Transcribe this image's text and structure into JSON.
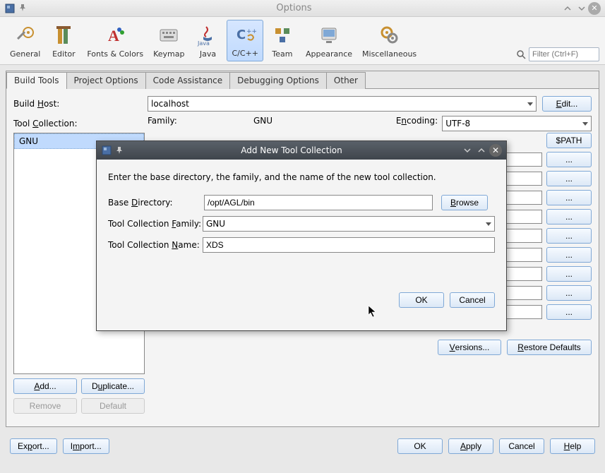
{
  "window": {
    "title": "Options"
  },
  "search": {
    "placeholder": "Filter (Ctrl+F)"
  },
  "categories": [
    {
      "id": "general",
      "label": "General"
    },
    {
      "id": "editor",
      "label": "Editor"
    },
    {
      "id": "fonts",
      "label": "Fonts & Colors"
    },
    {
      "id": "keymap",
      "label": "Keymap"
    },
    {
      "id": "java",
      "label": "Java"
    },
    {
      "id": "ccpp",
      "label": "C/C++",
      "selected": true
    },
    {
      "id": "team",
      "label": "Team"
    },
    {
      "id": "appearance",
      "label": "Appearance"
    },
    {
      "id": "misc",
      "label": "Miscellaneous"
    }
  ],
  "tabs": [
    "Build Tools",
    "Project Options",
    "Code Assistance",
    "Debugging Options",
    "Other"
  ],
  "active_tab": "Build Tools",
  "build": {
    "build_host_label": "Build Host:",
    "build_host_value": "localhost",
    "edit_btn": "Edit...",
    "tool_collection_label": "Tool Collection:",
    "list_items": [
      "GNU"
    ],
    "add_btn": "Add...",
    "duplicate_btn": "Duplicate...",
    "remove_btn": "Remove",
    "default_btn": "Default",
    "family_label": "Family:",
    "family_value": "GNU",
    "encoding_label": "Encoding:",
    "encoding_value": "UTF-8",
    "path_btn": "$PATH",
    "dots_btn": "...",
    "versions_btn": "Versions...",
    "restore_btn": "Restore Defaults"
  },
  "footer": {
    "export": "Export...",
    "import": "Import...",
    "ok": "OK",
    "apply": "Apply",
    "cancel": "Cancel",
    "help": "Help"
  },
  "modal": {
    "title": "Add New Tool Collection",
    "desc": "Enter the base directory, the family, and the name of the new tool collection.",
    "base_dir_label": "Base Directory:",
    "base_dir_value": "/opt/AGL/bin",
    "browse": "Browse",
    "family_label": "Tool Collection Family:",
    "family_value": "GNU",
    "name_label": "Tool Collection Name:",
    "name_value": "XDS",
    "ok": "OK",
    "cancel": "Cancel"
  }
}
